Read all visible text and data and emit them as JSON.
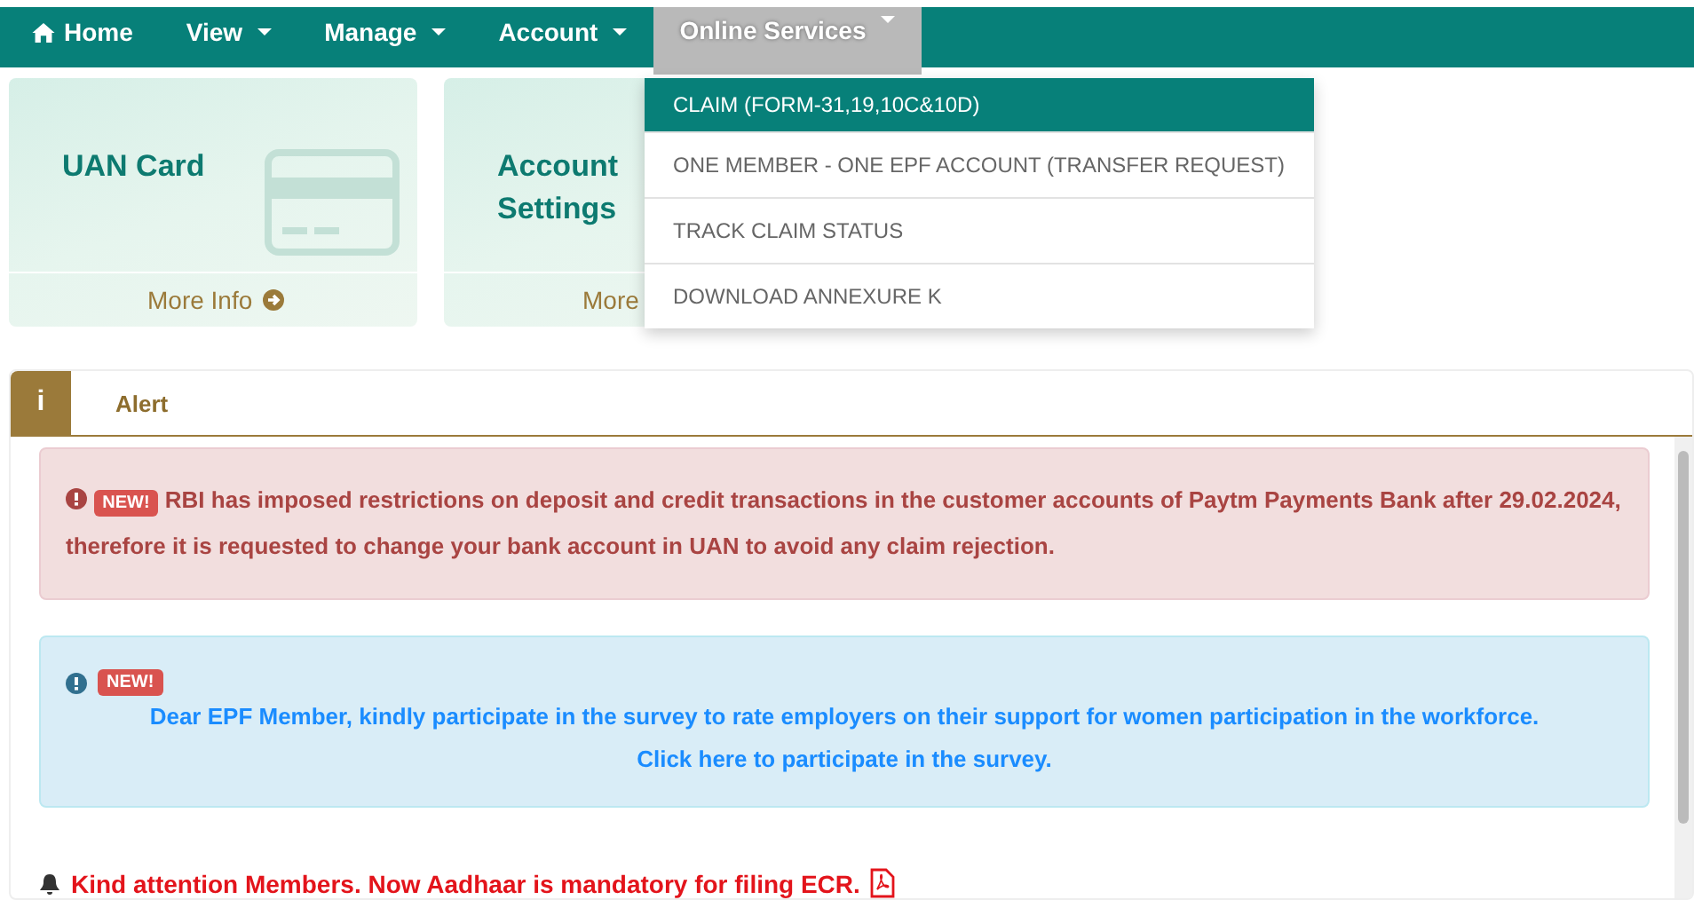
{
  "nav": [
    {
      "label": "Home",
      "kind": "home",
      "selected": false
    },
    {
      "label": "View",
      "kind": "dropdown",
      "selected": false
    },
    {
      "label": "Manage",
      "kind": "dropdown",
      "selected": false
    },
    {
      "label": "Account",
      "kind": "dropdown",
      "selected": false
    },
    {
      "label": "Online Services",
      "kind": "dropdown",
      "selected": true
    }
  ],
  "cards": [
    {
      "title": "UAN Card",
      "more": "More Info",
      "show_icon": true,
      "link_icon": true
    },
    {
      "title": "Account Settings",
      "more": "More",
      "show_icon": false,
      "link_icon": false
    }
  ],
  "dropdown": [
    {
      "label": "CLAIM (FORM-31,19,10C&10D)",
      "selected": true
    },
    {
      "label": "ONE MEMBER - ONE EPF ACCOUNT (TRANSFER REQUEST)",
      "selected": false
    },
    {
      "label": "TRACK CLAIM STATUS",
      "selected": false
    },
    {
      "label": "DOWNLOAD ANNEXURE K",
      "selected": false
    }
  ],
  "alert": {
    "icon": "i",
    "title": "Alert",
    "messages": [
      {
        "kind": "danger",
        "badge": "NEW!",
        "text": "RBI has imposed restrictions on deposit and credit transactions in the customer accounts of Paytm Payments Bank after 29.02.2024, therefore it is requested to change your bank account in UAN to avoid any claim rejection."
      },
      {
        "kind": "info",
        "badge": "NEW!",
        "text": "Dear EPF Member, kindly participate in the survey to rate employers on their support for women participation in the workforce.",
        "link": "Click here to participate in the survey."
      }
    ],
    "notice": "Kind attention Members. Now Aadhaar is mandatory for filing ECR."
  }
}
